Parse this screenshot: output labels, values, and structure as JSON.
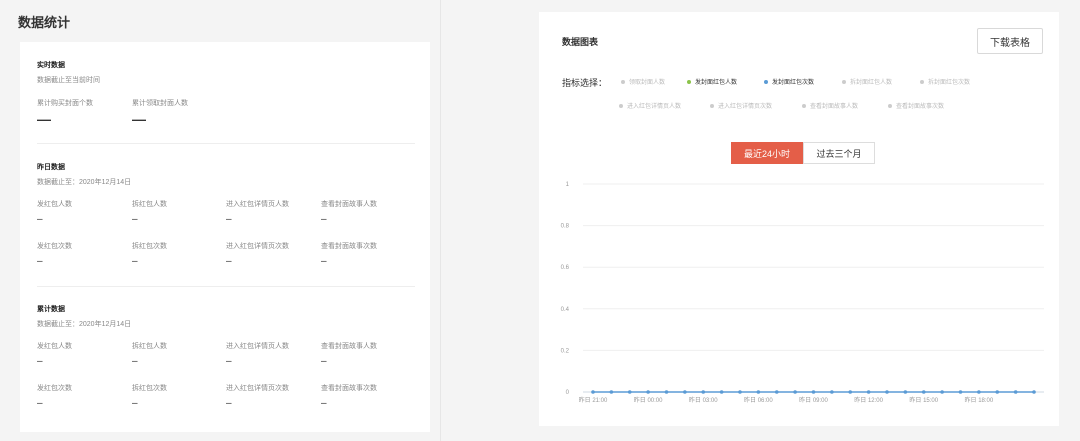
{
  "left": {
    "title": "数据统计",
    "realtime": {
      "title": "实时数据",
      "subtitle": "数据截止至当前时间",
      "metrics": [
        {
          "label": "累计购买封面个数",
          "value": "—"
        },
        {
          "label": "累计领取封面人数",
          "value": "—"
        }
      ]
    },
    "yesterday": {
      "title": "昨日数据",
      "subtitle": "数据截止至：2020年12月14日",
      "metrics": [
        {
          "label": "发红包人数",
          "value": "–"
        },
        {
          "label": "拆红包人数",
          "value": "–"
        },
        {
          "label": "进入红包详情页人数",
          "value": "–"
        },
        {
          "label": "查看封面故事人数",
          "value": "–"
        },
        {
          "label": "发红包次数",
          "value": "–"
        },
        {
          "label": "拆红包次数",
          "value": "–"
        },
        {
          "label": "进入红包详情页次数",
          "value": "–"
        },
        {
          "label": "查看封面故事次数",
          "value": "–"
        }
      ]
    },
    "cumulative": {
      "title": "累计数据",
      "subtitle": "数据截止至：2020年12月14日",
      "metrics": [
        {
          "label": "发红包人数",
          "value": "–"
        },
        {
          "label": "拆红包人数",
          "value": "–"
        },
        {
          "label": "进入红包详情页人数",
          "value": "–"
        },
        {
          "label": "查看封面故事人数",
          "value": "–"
        },
        {
          "label": "发红包次数",
          "value": "–"
        },
        {
          "label": "拆红包次数",
          "value": "–"
        },
        {
          "label": "进入红包详情页次数",
          "value": "–"
        },
        {
          "label": "查看封面故事次数",
          "value": "–"
        }
      ]
    }
  },
  "right": {
    "title": "数据图表",
    "download_label": "下载表格",
    "select_label": "指标选择：",
    "indicators": [
      {
        "label": "领取封面人数",
        "active": false,
        "color": "#cccccc"
      },
      {
        "label": "发封面红包人数",
        "active": true,
        "color": "#8bc34a"
      },
      {
        "label": "发封面红包次数",
        "active": true,
        "color": "#5b9bd5"
      },
      {
        "label": "拆封面红包人数",
        "active": false,
        "color": "#cccccc"
      },
      {
        "label": "拆封面红包次数",
        "active": false,
        "color": "#cccccc"
      },
      {
        "label": "进入红包详情页人数",
        "active": false,
        "color": "#cccccc"
      },
      {
        "label": "进入红包详情页次数",
        "active": false,
        "color": "#cccccc"
      },
      {
        "label": "查看封面故事人数",
        "active": false,
        "color": "#cccccc"
      },
      {
        "label": "查看封面故事次数",
        "active": false,
        "color": "#cccccc"
      }
    ],
    "range_buttons": [
      {
        "label": "最近24小时",
        "active": true
      },
      {
        "label": "过去三个月",
        "active": false
      }
    ],
    "accent_color": "#e45e48"
  },
  "chart_data": {
    "type": "line",
    "title": "",
    "xlabel": "",
    "ylabel": "",
    "ylim": [
      0,
      1
    ],
    "y_ticks": [
      "0",
      "0.2",
      "0.4",
      "0.6",
      "0.8",
      "1"
    ],
    "x_tick_labels": [
      "昨日 21:00",
      "昨日 00:00",
      "昨日 03:00",
      "昨日 06:00",
      "昨日 09:00",
      "昨日 12:00",
      "昨日 15:00",
      "昨日 18:00"
    ],
    "series": [
      {
        "values": [
          0,
          0,
          0,
          0,
          0,
          0,
          0,
          0,
          0,
          0,
          0,
          0,
          0,
          0,
          0,
          0,
          0,
          0,
          0,
          0,
          0,
          0,
          0,
          0,
          0
        ],
        "color": "#5b9bd5"
      }
    ],
    "grid": true
  }
}
